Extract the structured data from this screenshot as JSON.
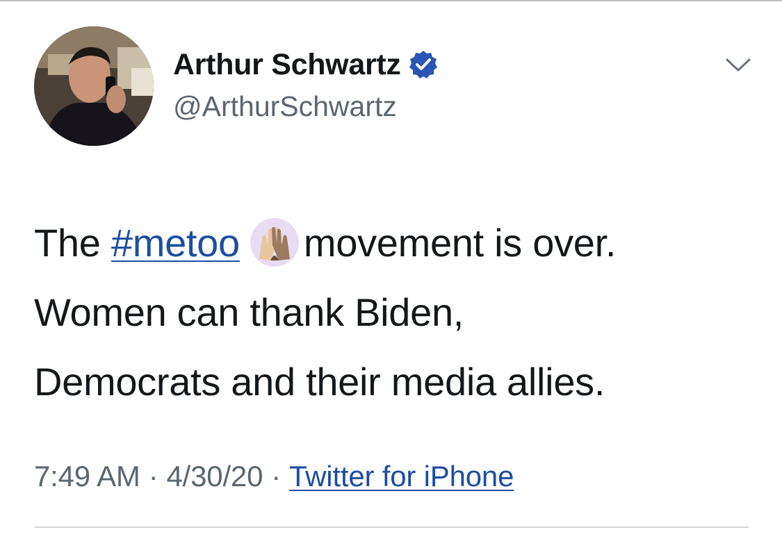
{
  "tweet": {
    "author": {
      "display_name": "Arthur Schwartz",
      "handle": "@ArthurSchwartz",
      "verified": true,
      "verified_icon": "verified-badge-icon"
    },
    "menu_icon": "chevron-down-icon",
    "text": {
      "prefix": "The",
      "hashtag": "#metoo",
      "hashtag_emoji": "raised-hands-emoji",
      "line1_rest": "movement is over.",
      "line2": "Women can thank Biden,",
      "line3": "Democrats and their media allies."
    },
    "meta": {
      "time": "7:49 AM",
      "separator": "·",
      "date": "4/30/20",
      "source": "Twitter for iPhone"
    }
  },
  "colors": {
    "link": "#1c4ea1",
    "text": "#14171a",
    "secondary": "#5b6670",
    "verified_badge": "#2a55b5"
  }
}
